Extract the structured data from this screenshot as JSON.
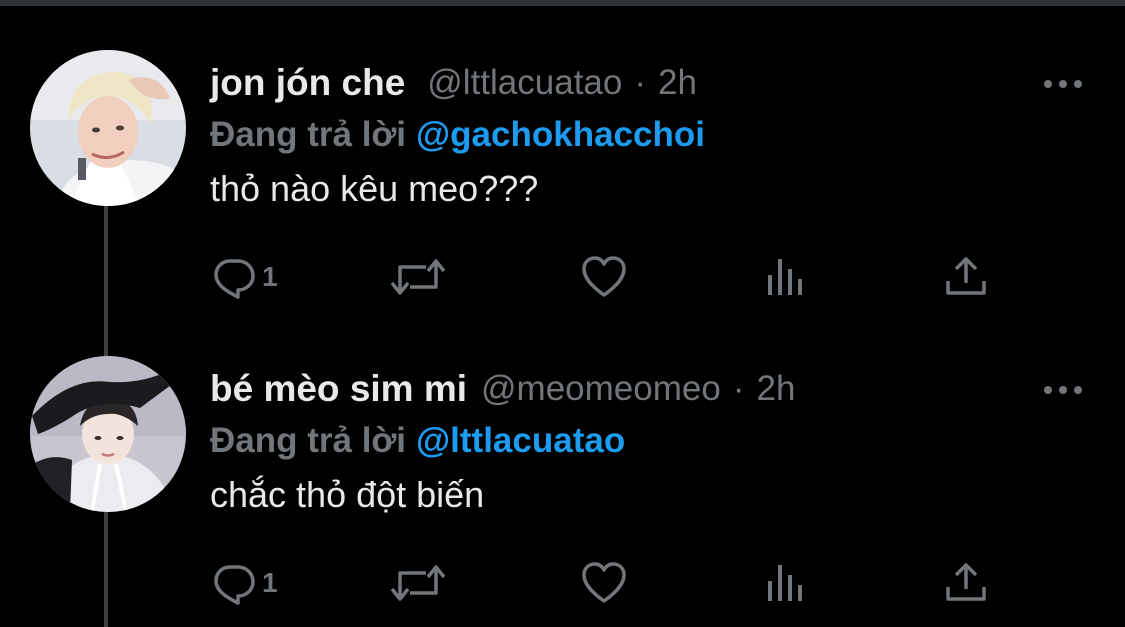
{
  "tweets": [
    {
      "display_name": "jon jón che",
      "handle": "@lttlacuatao",
      "separator": "·",
      "time": "2h",
      "replying_prefix": "Đang trả lời",
      "replying_to": "@gachokhacchoi",
      "text": "thỏ nào kêu meo???",
      "reply_count": "1",
      "avatar": "avatar-blonde-person"
    },
    {
      "display_name": "bé mèo sim mi",
      "handle": "@meomeomeo",
      "separator": "·",
      "time": "2h",
      "replying_prefix": "Đang trả lời",
      "replying_to": "@lttlacuatao",
      "text": "chắc thỏ đột biến",
      "reply_count": "1",
      "avatar": "avatar-person-black-hat"
    }
  ],
  "icons": {
    "reply": "reply-icon",
    "retweet": "retweet-icon",
    "like": "like-icon",
    "analytics": "analytics-icon",
    "share": "share-icon",
    "more": "more-icon"
  },
  "colors": {
    "background": "#000000",
    "text": "#e7e9ea",
    "muted": "#71767b",
    "link": "#1d9bf0",
    "thread_line": "#3e4144"
  }
}
